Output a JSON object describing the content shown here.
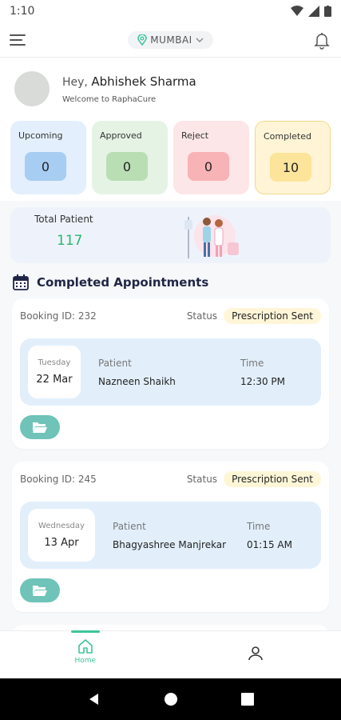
{
  "status_bar": {
    "time": "1:10"
  },
  "app_bar": {
    "location": "MUMBAI"
  },
  "user": {
    "greeting": "Hey,",
    "name": "Abhishek Sharma",
    "welcome": "Welcome to RaphaCure"
  },
  "stats": [
    {
      "label": "Upcoming",
      "value": "0"
    },
    {
      "label": "Approved",
      "value": "0"
    },
    {
      "label": "Reject",
      "value": "0"
    },
    {
      "label": "Completed",
      "value": "10"
    }
  ],
  "total": {
    "label": "Total Patient",
    "value": "117"
  },
  "section": {
    "title": "Completed Appointments"
  },
  "appointments": [
    {
      "booking": "Booking ID: 232",
      "status_label": "Status",
      "status": "Prescription Sent",
      "day": "Tuesday",
      "date": "22 Mar",
      "patient_label": "Patient",
      "patient": "Nazneen Shaikh",
      "time_label": "Time",
      "time": "12:30 PM"
    },
    {
      "booking": "Booking ID: 245",
      "status_label": "Status",
      "status": "Prescription Sent",
      "day": "Wednesday",
      "date": "13 Apr",
      "patient_label": "Patient",
      "patient": "Bhagyashree Manjrekar",
      "time_label": "Time",
      "time": "01:15 AM"
    }
  ],
  "bottom_nav": {
    "home": "Home"
  },
  "colors": {
    "accent": "#3cc59a",
    "total": "#2bb56f",
    "folder": "#6fc3b8"
  }
}
